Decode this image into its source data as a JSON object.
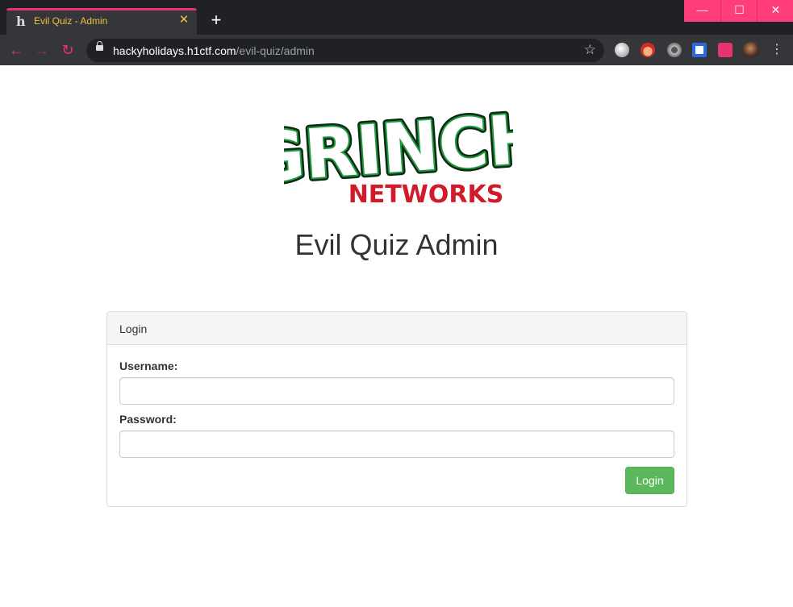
{
  "browser": {
    "tab": {
      "favicon_char": "h",
      "title": "Evil Quiz - Admin",
      "close_glyph": "✕"
    },
    "new_tab_glyph": "+",
    "window_controls": {
      "minimize": "—",
      "maximize": "☐",
      "close": "✕"
    },
    "nav": {
      "back": "←",
      "forward": "→",
      "reload": "↻"
    },
    "omnibox": {
      "host": "hackyholidays.h1ctf.com",
      "path": "/evil-quiz/admin",
      "star": "☆"
    },
    "extensions": [
      "globe-ext-icon",
      "santa-ext-icon",
      "gear-ext-icon",
      "shield-ext-icon",
      "puzzle-icon",
      "profile-avatar"
    ],
    "menu_glyph": "⋮",
    "accent_color": "#e8336f",
    "window_control_color": "#ff3d7a"
  },
  "logo": {
    "line1": "GRINCH",
    "line2": "NETWORKS",
    "green": "#1f9a3e",
    "red": "#d11b2a"
  },
  "page": {
    "title": "Evil Quiz Admin"
  },
  "login_panel": {
    "heading": "Login",
    "username_label": "Username:",
    "username_value": "",
    "password_label": "Password:",
    "password_value": "",
    "submit_label": "Login"
  }
}
